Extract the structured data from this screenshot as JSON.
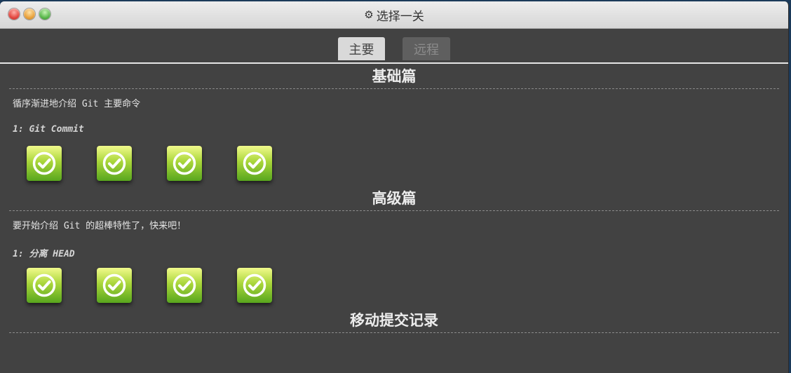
{
  "window": {
    "title": "选择一关",
    "title_icon": "gear-icon"
  },
  "tabs": [
    {
      "label": "主要",
      "active": true
    },
    {
      "label": "远程",
      "active": false
    }
  ],
  "sections": [
    {
      "title": "基础篇",
      "description": "循序渐进地介绍 Git 主要命令",
      "level_name": "1: Git Commit",
      "levels": [
        {
          "status": "completed",
          "icon": "check-icon"
        },
        {
          "status": "completed",
          "icon": "check-icon"
        },
        {
          "status": "completed",
          "icon": "check-icon"
        },
        {
          "status": "completed",
          "icon": "check-icon"
        }
      ]
    },
    {
      "title": "高级篇",
      "description": "要开始介绍 Git 的超棒特性了，快来吧！",
      "level_name": "1: 分离 HEAD",
      "levels": [
        {
          "status": "completed",
          "icon": "check-icon"
        },
        {
          "status": "completed",
          "icon": "check-icon"
        },
        {
          "status": "completed",
          "icon": "check-icon"
        },
        {
          "status": "completed",
          "icon": "check-icon"
        }
      ]
    },
    {
      "title": "移动提交记录"
    }
  ],
  "colors": {
    "background": "#424242",
    "level_complete_top": "#f2fa8c",
    "level_complete_bottom": "#58a61e"
  }
}
